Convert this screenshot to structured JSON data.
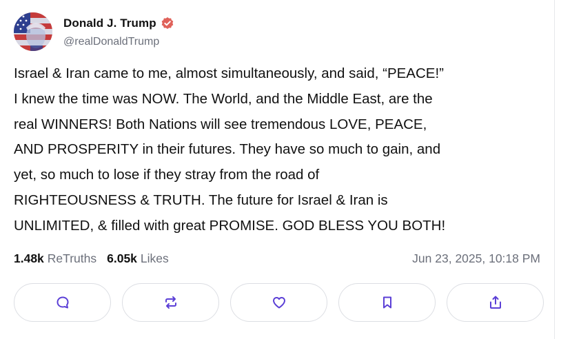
{
  "post": {
    "display_name": "Donald J. Trump",
    "handle": "@realDonaldTrump",
    "text": "Israel & Iran came to me, almost simultaneously, and said, “PEACE!”\nI knew the time was NOW. The World, and the Middle East, are the\nreal WINNERS! Both Nations will see tremendous LOVE, PEACE,\nAND PROSPERITY in their futures. They have so much to gain, and\nyet, so much to lose if they stray from the road of\nRIGHTEOUSNESS & TRUTH. The future for Israel & Iran is\nUNLIMITED, & filled with great PROMISE. GOD BLESS YOU BOTH!",
    "retruths_count": "1.48k",
    "retruths_label": "ReTruths",
    "likes_count": "6.05k",
    "likes_label": "Likes",
    "timestamp": "Jun 23, 2025, 10:18 PM"
  },
  "icons": {
    "verified": "verified-badge-icon",
    "reply": "reply-icon",
    "retruth": "retruth-icon",
    "like": "heart-icon",
    "bookmark": "bookmark-icon",
    "share": "share-icon"
  },
  "colors": {
    "verified_badge": "#e0625a",
    "icon_accent": "#5b3fd6",
    "muted_text": "#6b6f7a",
    "border": "#dcdee3"
  }
}
